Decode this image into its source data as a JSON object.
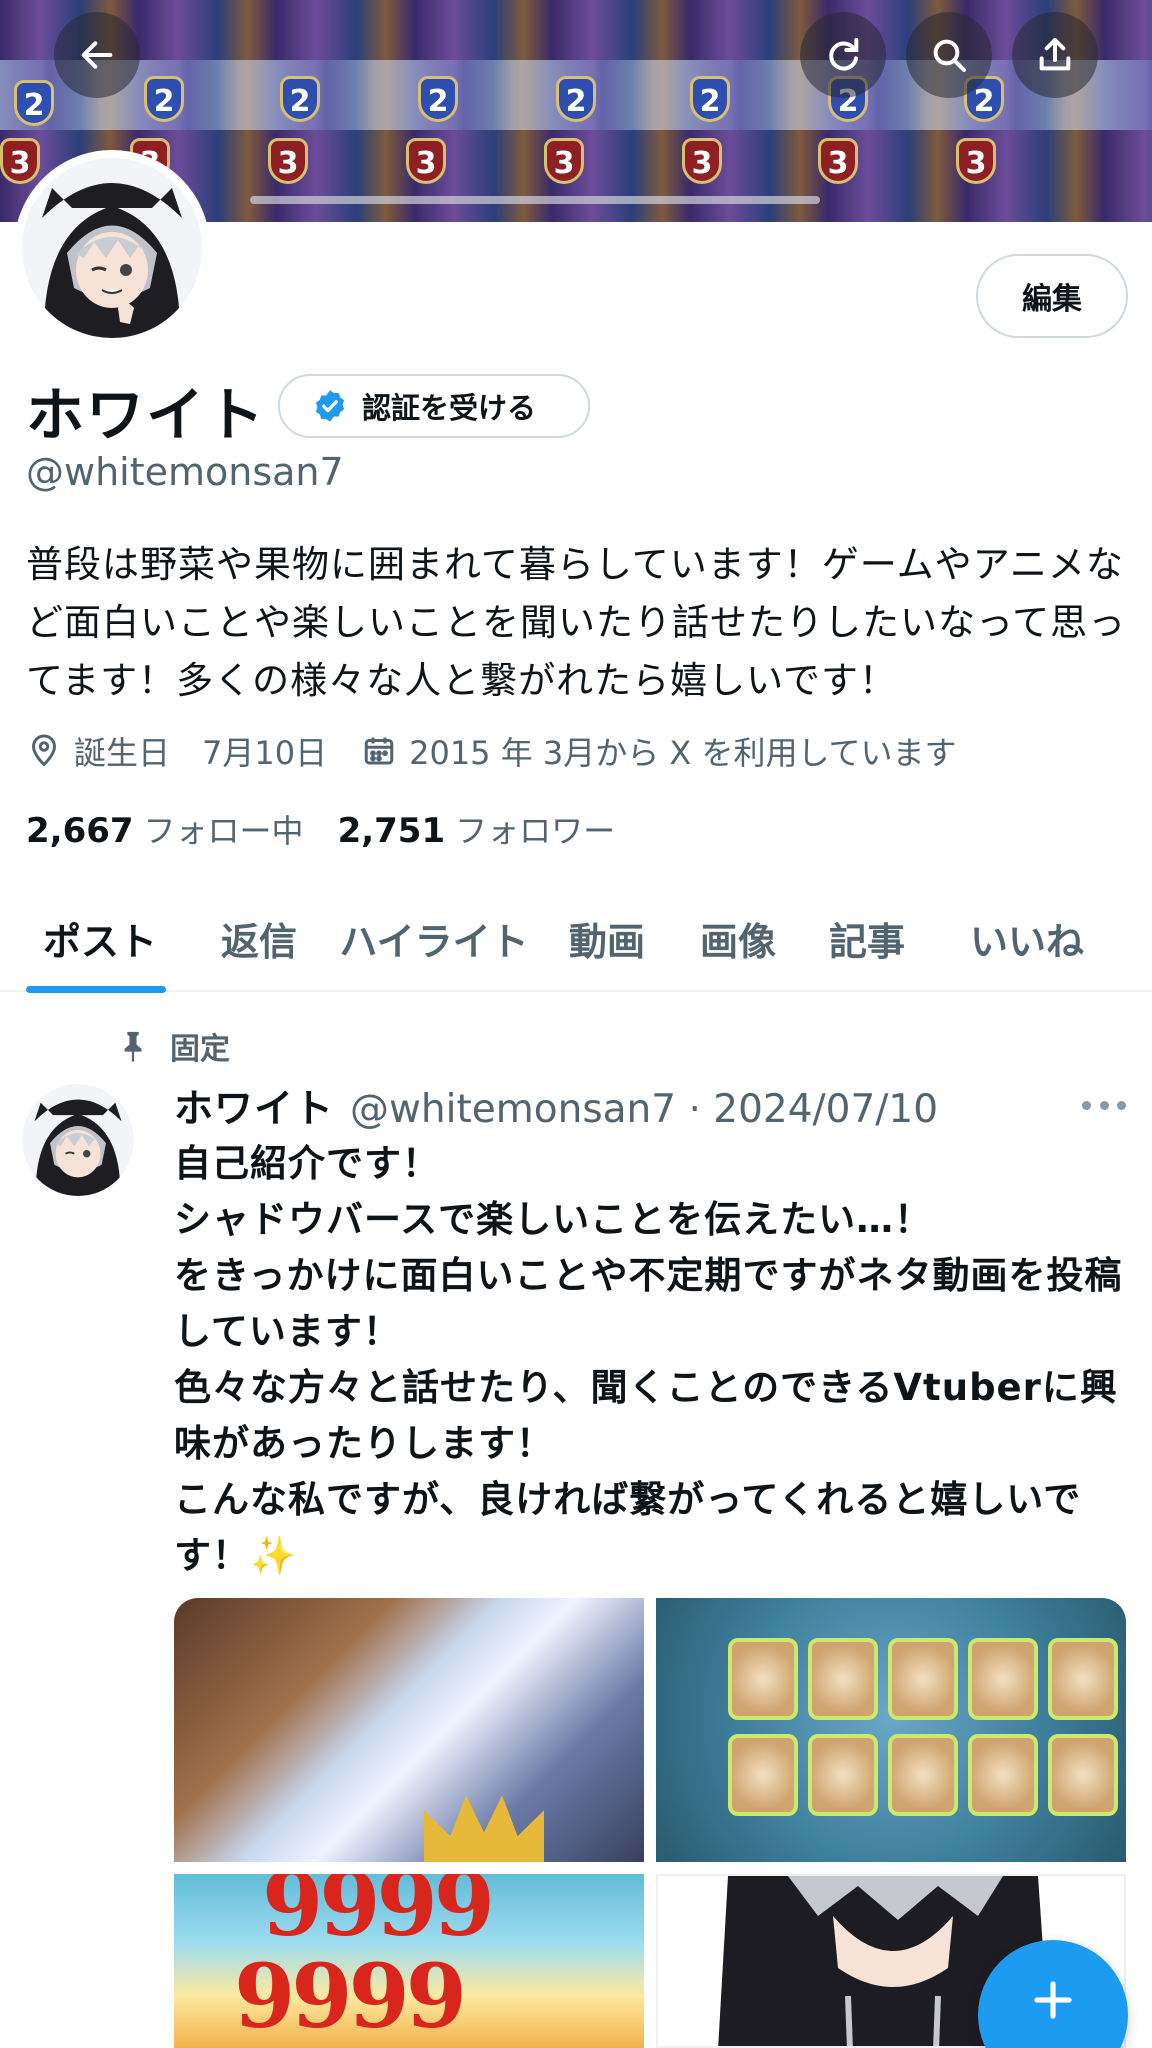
{
  "header": {
    "back_icon": "arrow-left-icon",
    "actions": [
      "refresh-icon",
      "search-icon",
      "share-icon"
    ]
  },
  "profile": {
    "display_name": "ホワイト",
    "verify_label": "認証を受ける",
    "handle": "@whitemonsan7",
    "edit_label": "編集",
    "bio": "普段は野菜や果物に囲まれて暮らしています！ゲームやアニメなど面白いことや楽しいことを聞いたり話せたりしたいなって思ってます！多くの様々な人と繋がれたら嬉しいです！",
    "birthday": "誕生日　7月10日",
    "joined": "2015 年 3月から X を利用しています",
    "following_count": "2,667",
    "following_label": "フォロー中",
    "followers_count": "2,751",
    "followers_label": "フォロワー"
  },
  "tabs": [
    {
      "label": "ポスト",
      "active": true
    },
    {
      "label": "返信",
      "active": false
    },
    {
      "label": "ハイライト",
      "active": false
    },
    {
      "label": "動画",
      "active": false
    },
    {
      "label": "画像",
      "active": false
    },
    {
      "label": "記事",
      "active": false
    },
    {
      "label": "いいね",
      "active": false
    }
  ],
  "post": {
    "pinned_label": "固定",
    "author_name": "ホワイト",
    "author_handle": "@whitemonsan7",
    "date": "2024/07/10",
    "handle_date": "@whitemonsan7 · 2024/07/10",
    "text": "自己紹介です！\nシャドウバースで楽しいことを伝えたい…！\nをきっかけに面白いことや不定期ですがネタ動画を投稿しています！\n色々な方々と話せたり、聞くことのできるVtuberに興味があったりします！\nこんな私ですが、良ければ繋がってくれると嬉しいです！✨",
    "media_overlay_text": "9999"
  },
  "colors": {
    "accent": "#1d9bf0",
    "text_primary": "#0f1419",
    "text_secondary": "#536471",
    "border": "#cfd9de"
  },
  "fab_icon": "plus-icon"
}
